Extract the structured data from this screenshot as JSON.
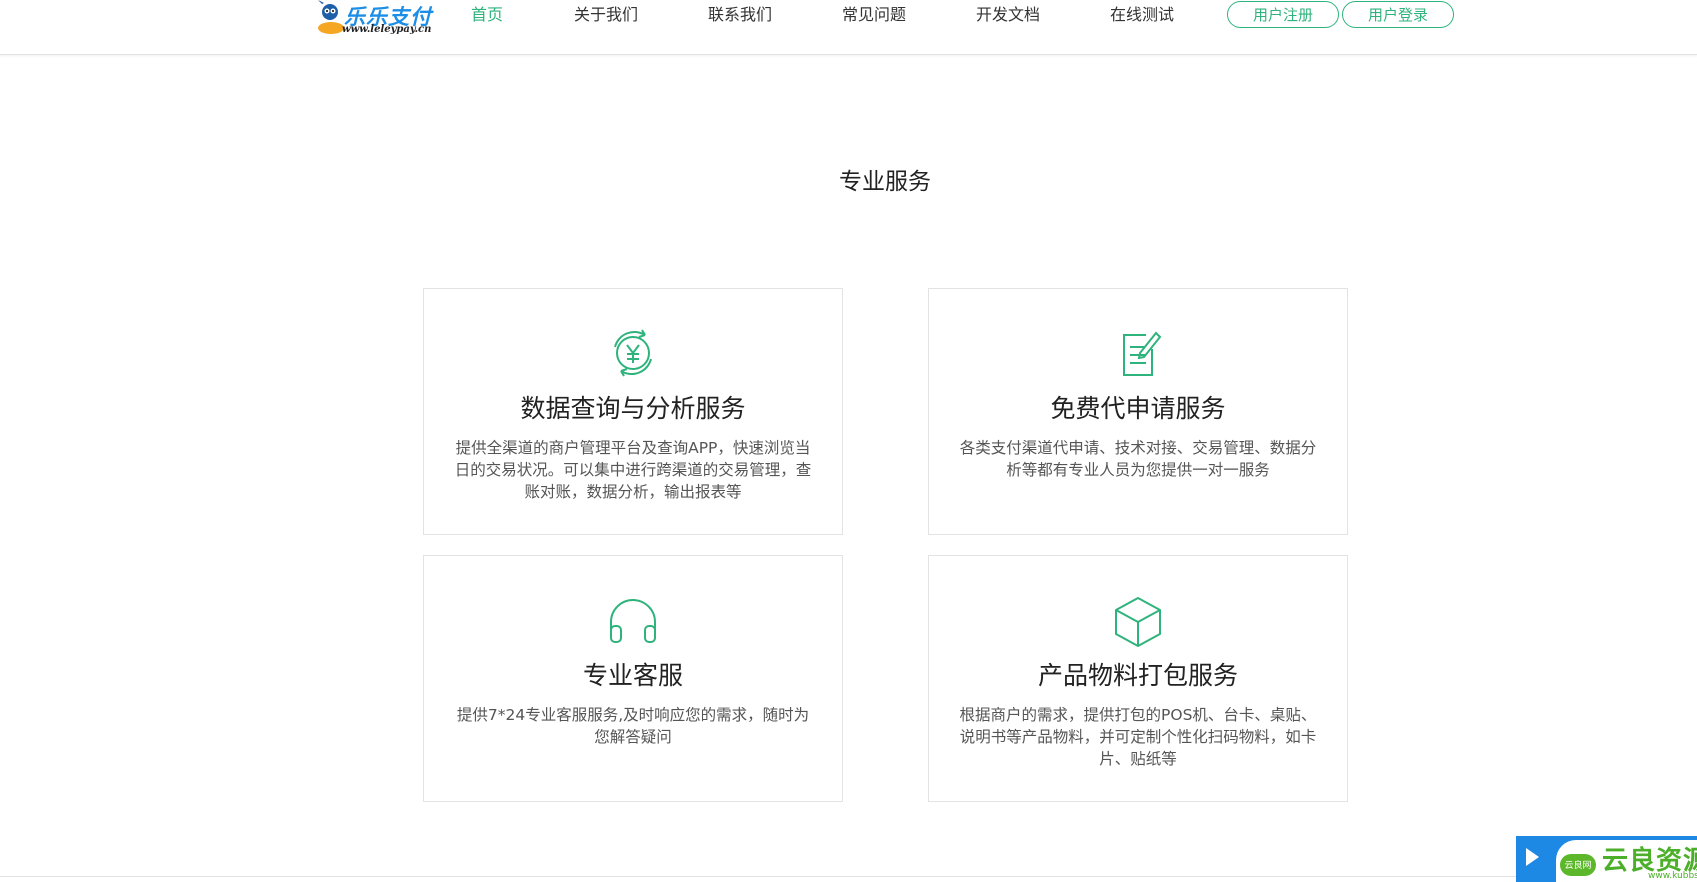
{
  "header": {
    "logo_text": "乐乐支付",
    "logo_url": "www.leleypay.cn",
    "nav": [
      {
        "label": "首页",
        "active": true
      },
      {
        "label": "关于我们"
      },
      {
        "label": "联系我们"
      },
      {
        "label": "常见问题"
      },
      {
        "label": "开发文档"
      },
      {
        "label": "在线测试"
      }
    ],
    "register_label": "用户注册",
    "login_label": "用户登录"
  },
  "section": {
    "title": "专业服务"
  },
  "services": [
    {
      "icon": "yuan-cycle-icon",
      "title": "数据查询与分析服务",
      "desc": "提供全渠道的商户管理平台及查询APP，快速浏览当日的交易状况。可以集中进行跨渠道的交易管理，查账对账，数据分析，输出报表等"
    },
    {
      "icon": "document-edit-icon",
      "title": "免费代申请服务",
      "desc": "各类支付渠道代申请、技术对接、交易管理、数据分析等都有专业人员为您提供一对一服务"
    },
    {
      "icon": "headphones-icon",
      "title": "专业客服",
      "desc": "提供7*24专业客服服务,及时响应您的需求，随时为您解答疑问"
    },
    {
      "icon": "box-icon",
      "title": "产品物料打包服务",
      "desc": "根据商户的需求，提供打包的POS机、台卡、桌贴、说明书等产品物料，并可定制个性化扫码物料，如卡片、贴纸等"
    }
  ],
  "watermark": {
    "cloud_text": "云良网",
    "brand": "云良资源网",
    "url": "www.kubbs.cn"
  },
  "colors": {
    "accent": "#2fb37c",
    "float_blue": "#1e88e5",
    "watermark_green": "#4caf29"
  }
}
